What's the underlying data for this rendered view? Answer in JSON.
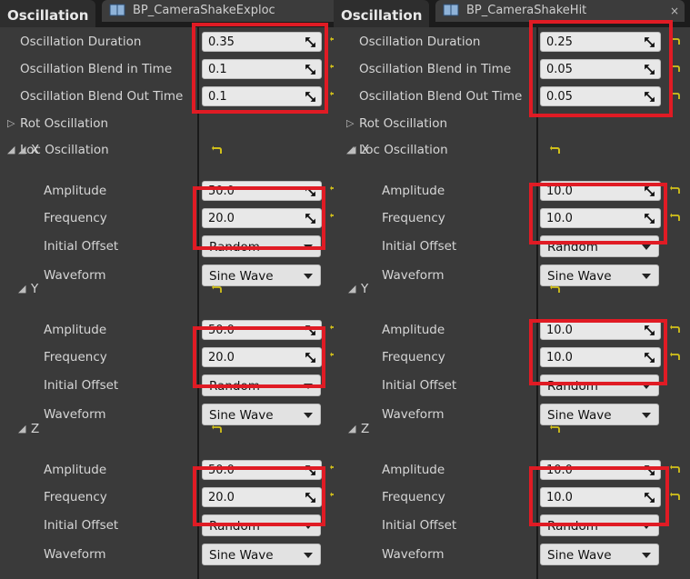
{
  "panels": [
    {
      "section_title": "Oscillation",
      "doc_tab": "BP_CameraShakeExploc",
      "params": [
        {
          "label": "Oscillation Duration",
          "value": "0.35"
        },
        {
          "label": "Oscillation Blend in Time",
          "value": "0.1"
        },
        {
          "label": "Oscillation Blend Out Time",
          "value": "0.1"
        }
      ],
      "rot_label": "Rot Oscillation",
      "loc_label": "Loc Oscillation",
      "axes": [
        {
          "name": "X",
          "amplitude_label": "Amplitude",
          "amplitude": "50.0",
          "frequency_label": "Frequency",
          "frequency": "20.0",
          "offset_label": "Initial Offset",
          "offset": "Random",
          "waveform_label": "Waveform",
          "waveform": "Sine Wave"
        },
        {
          "name": "Y",
          "amplitude_label": "Amplitude",
          "amplitude": "50.0",
          "frequency_label": "Frequency",
          "frequency": "20.0",
          "offset_label": "Initial Offset",
          "offset": "Random",
          "waveform_label": "Waveform",
          "waveform": "Sine Wave"
        },
        {
          "name": "Z",
          "amplitude_label": "Amplitude",
          "amplitude": "50.0",
          "frequency_label": "Frequency",
          "frequency": "20.0",
          "offset_label": "Initial Offset",
          "offset": "Random",
          "waveform_label": "Waveform",
          "waveform": "Sine Wave"
        }
      ]
    },
    {
      "section_title": "Oscillation",
      "doc_tab": "BP_CameraShakeHit",
      "params": [
        {
          "label": "Oscillation Duration",
          "value": "0.25"
        },
        {
          "label": "Oscillation Blend in Time",
          "value": "0.05"
        },
        {
          "label": "Oscillation Blend Out Time",
          "value": "0.05"
        }
      ],
      "rot_label": "Rot Oscillation",
      "loc_label": "Loc Oscillation",
      "axes": [
        {
          "name": "X",
          "amplitude_label": "Amplitude",
          "amplitude": "10.0",
          "frequency_label": "Frequency",
          "frequency": "10.0",
          "offset_label": "Initial Offset",
          "offset": "Random",
          "waveform_label": "Waveform",
          "waveform": "Sine Wave"
        },
        {
          "name": "Y",
          "amplitude_label": "Amplitude",
          "amplitude": "10.0",
          "frequency_label": "Frequency",
          "frequency": "10.0",
          "offset_label": "Initial Offset",
          "offset": "Random",
          "waveform_label": "Waveform",
          "waveform": "Sine Wave"
        },
        {
          "name": "Z",
          "amplitude_label": "Amplitude",
          "amplitude": "10.0",
          "frequency_label": "Frequency",
          "frequency": "10.0",
          "offset_label": "Initial Offset",
          "offset": "Random",
          "waveform_label": "Waveform",
          "waveform": "Sine Wave"
        }
      ]
    }
  ],
  "colors": {
    "highlight": "#e01b24",
    "reset_arrow": "#d4c21a",
    "panel_bg": "#3a3a3a",
    "field_bg": "#e8e8e8"
  },
  "icons": [
    "book-icon",
    "close-icon",
    "expand-arrow-icon",
    "collapse-arrow-icon",
    "drag-handle-icon",
    "reset-to-default-icon",
    "dropdown-caret-icon"
  ]
}
